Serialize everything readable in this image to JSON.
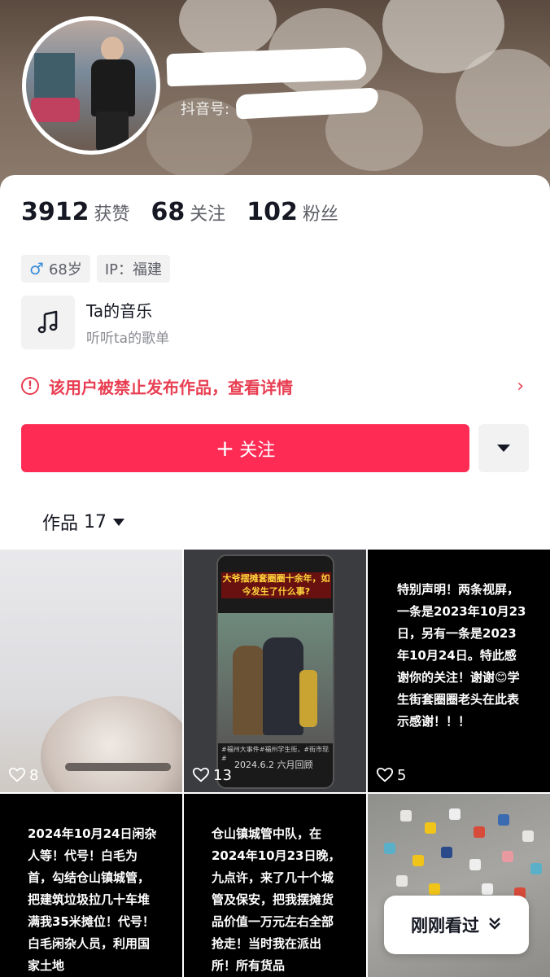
{
  "profile": {
    "douyin_id_label": "抖音号:",
    "stats": [
      {
        "value": "3912",
        "label": "获赞"
      },
      {
        "value": "68",
        "label": "关注"
      },
      {
        "value": "102",
        "label": "粉丝"
      }
    ],
    "tags": {
      "age": "68岁",
      "ip": "IP：福建"
    },
    "music": {
      "title": "Ta的音乐",
      "subtitle": "听听ta的歌单"
    },
    "ban_notice": "该用户被禁止发布作品，查看详情",
    "follow_label": "关注"
  },
  "works_tab": {
    "label": "作品",
    "count": "17"
  },
  "grid": [
    {
      "likes": "8"
    },
    {
      "likes": "13",
      "title": "大爷摆摊套圈圈十余年，如今发生了什么事?",
      "tags": "#福州大事件#福州学生街，#街市现#",
      "date": "2024.6.2 六月回顾"
    },
    {
      "likes": "5",
      "text": "特别声明！两条视屏，一条是2023年10月23日，另有一条是2023年10月24日。特此感谢你的关注！谢谢😊学生街套圈圈老头在此表示感谢！！！"
    },
    {
      "text": "2024年10月24日闲杂人等！代号！白毛为首，勾结仓山镇城管，把建筑垃圾拉几十车堆满我35米摊位！代号！白毛闲杂人员，利用国家土地"
    },
    {
      "text": "仓山镇城管中队，在2024年10月23日晚，九点许，来了几十个城管及保安，把我摆摊货品价值一万元左右全部抢走！当时我在派出所！所有货品"
    },
    {}
  ],
  "recent_button": "刚刚看过",
  "colors": {
    "accent": "#fe2c55",
    "ban_red": "#e83e52",
    "male_blue": "#3b8fd9"
  },
  "icons": [
    "music-note-icon",
    "warning-circle-icon",
    "chevron-right-icon",
    "plus-icon",
    "caret-down-icon",
    "heart-icon",
    "double-chevron-down-icon"
  ]
}
